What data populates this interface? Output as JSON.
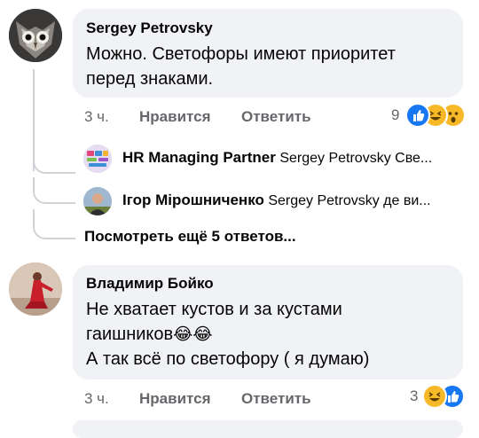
{
  "comments": [
    {
      "author": "Sergey Petrovsky",
      "lines": [
        "Можно. Светофоры имеют приоритет",
        "перед знаками."
      ],
      "time": "3 ч.",
      "like_label": "Нравится",
      "reply_label": "Ответить",
      "reaction_count": "9",
      "reactions": [
        "like-icon",
        "haha-icon",
        "wow-icon"
      ]
    },
    {
      "author": "Владимир Бойко",
      "lines": [
        "Не хватает кустов и за кустами",
        "гаишников",
        "А так всё по светофору ( я думаю)"
      ],
      "emoji_inline": "😂😂",
      "time": "3 ч.",
      "like_label": "Нравится",
      "reply_label": "Ответить",
      "reaction_count": "3",
      "reactions": [
        "haha-icon",
        "like-icon"
      ]
    }
  ],
  "replies": [
    {
      "name": "HR Managing Partner",
      "text": "Sergey Petrovsky Све..."
    },
    {
      "name": "Ігор Мірошниченко",
      "text": "Sergey Petrovsky де ви..."
    }
  ],
  "more_replies_label": "Посмотреть ещё 5 ответов...",
  "colors": {
    "bubble": "#f0f2f5",
    "meta": "#65676b",
    "like_blue": "#1877f2",
    "haha_yellow": "#f7b928"
  }
}
